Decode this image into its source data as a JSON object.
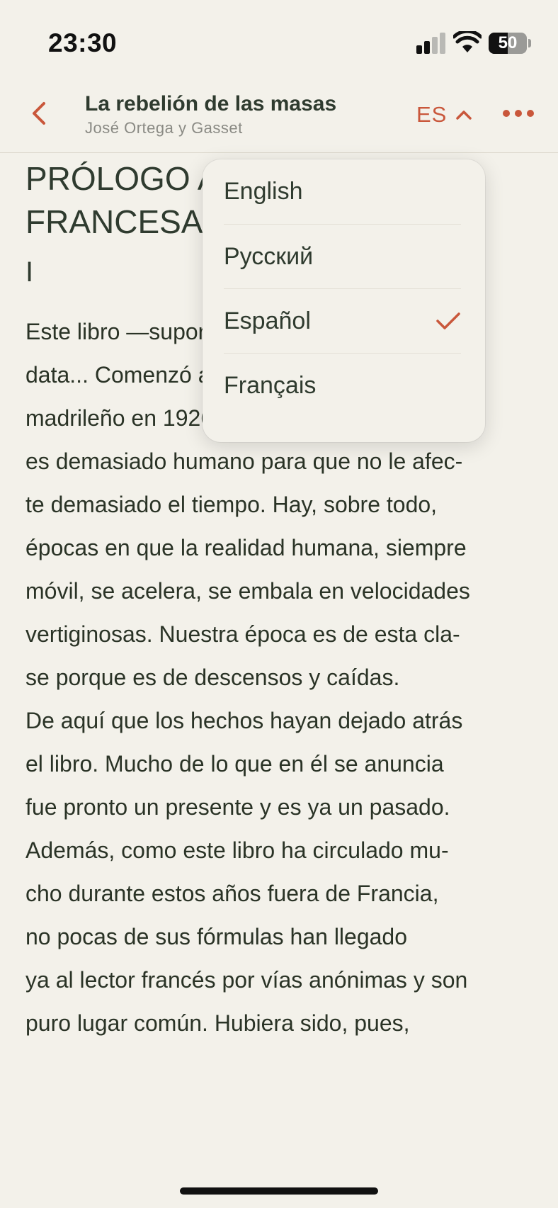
{
  "status_bar": {
    "time": "23:30",
    "battery_percent": "50",
    "signal_icon": "cellular-signal-icon",
    "wifi_icon": "wifi-icon"
  },
  "nav": {
    "back_icon": "chevron-left-icon",
    "title": "La rebelión de las masas",
    "author": "José Ortega y Gasset",
    "language_code": "ES",
    "more_icon": "ellipsis-icon"
  },
  "content": {
    "chapter_heading": "PRÓLOGO A LA EDICIÓN\nFRANCESA",
    "section_numeral": "I",
    "paragraph1_lines": [
      "Este libro —suponiendo que sea un libro—",
      "data... Comenzó a publicarse en un diario",
      "madrileño en 1926, y el asunto de que trata",
      "es demasiado humano para que no le afec-",
      "te demasiado el tiempo. Hay, sobre todo,",
      "épocas en que la realidad humana, siempre",
      "móvil, se acelera, se embala en velocidades",
      "vertiginosas. Nuestra época es de esta cla-",
      "se porque es de descensos y caídas."
    ],
    "paragraph2_lines": [
      "De aquí que los hechos hayan dejado atrás",
      "el libro. Mucho de lo que en él se anuncia",
      "fue pronto un presente y es ya un pasado.",
      "Además, como este libro ha circulado mu-",
      "cho durante estos años fuera de Francia,",
      "no pocas de sus fórmulas han llegado",
      "ya al lector francés por vías anónimas y son",
      "puro lugar común. Hubiera sido, pues,"
    ]
  },
  "language_menu": {
    "options": [
      {
        "label": "English",
        "selected": false
      },
      {
        "label": "Русский",
        "selected": false
      },
      {
        "label": "Español",
        "selected": true
      },
      {
        "label": "Français",
        "selected": false
      }
    ],
    "check_icon": "checkmark-icon"
  },
  "colors": {
    "accent": "#c9573b",
    "background": "#f3f1ea",
    "text": "#2c3328"
  }
}
